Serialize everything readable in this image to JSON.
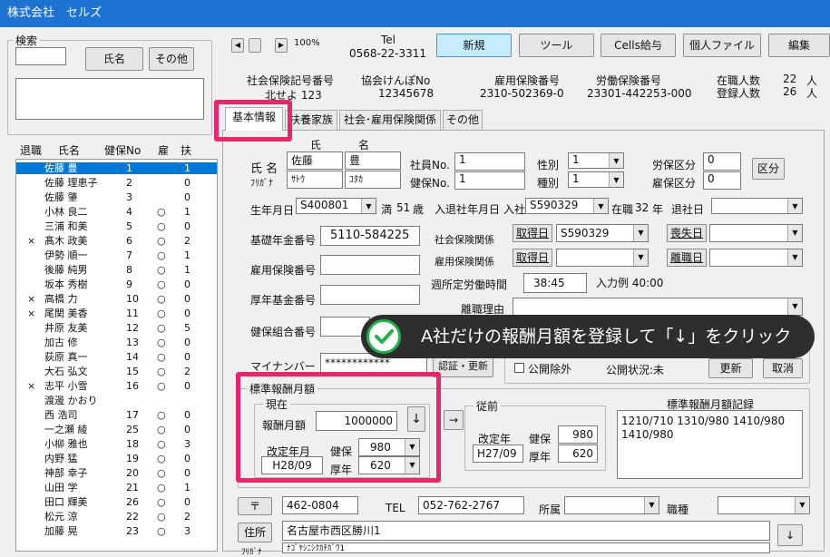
{
  "title": "株式会社　セルズ",
  "search": {
    "label": "検索",
    "name_btn": "氏名",
    "other_btn": "その他"
  },
  "list_headers": {
    "ret": "退職",
    "name": "氏名",
    "kenpo": "健保No",
    "emp": "雇",
    "dep": "扶"
  },
  "employees": [
    {
      "r": "",
      "n": "佐藤 豊",
      "k": "1",
      "e": "",
      "d": "1"
    },
    {
      "r": "",
      "n": "佐藤 理恵子",
      "k": "2",
      "e": "",
      "d": "0"
    },
    {
      "r": "",
      "n": "佐藤 肇",
      "k": "3",
      "e": "",
      "d": "0"
    },
    {
      "r": "",
      "n": "小林 良二",
      "k": "4",
      "e": "○",
      "d": "1"
    },
    {
      "r": "",
      "n": "三浦 和美",
      "k": "5",
      "e": "○",
      "d": "0"
    },
    {
      "r": "×",
      "n": "髙木 政美",
      "k": "6",
      "e": "○",
      "d": "2"
    },
    {
      "r": "",
      "n": "伊勢 順一",
      "k": "7",
      "e": "○",
      "d": "1"
    },
    {
      "r": "",
      "n": "後藤 純男",
      "k": "8",
      "e": "○",
      "d": "1"
    },
    {
      "r": "",
      "n": "坂本 秀樹",
      "k": "9",
      "e": "○",
      "d": "0"
    },
    {
      "r": "×",
      "n": "高橋 力",
      "k": "10",
      "e": "○",
      "d": "0"
    },
    {
      "r": "×",
      "n": "尾関 美香",
      "k": "11",
      "e": "○",
      "d": "0"
    },
    {
      "r": "",
      "n": "井原 友美",
      "k": "12",
      "e": "○",
      "d": "5"
    },
    {
      "r": "",
      "n": "加古 修",
      "k": "13",
      "e": "○",
      "d": "0"
    },
    {
      "r": "",
      "n": "荻原 真一",
      "k": "14",
      "e": "○",
      "d": "0"
    },
    {
      "r": "",
      "n": "大石 弘文",
      "k": "15",
      "e": "○",
      "d": "2"
    },
    {
      "r": "×",
      "n": "志平 小雪",
      "k": "16",
      "e": "○",
      "d": "0"
    },
    {
      "r": "",
      "n": "渡邊 かおり",
      "k": "",
      "e": "",
      "d": ""
    },
    {
      "r": "",
      "n": "西 浩司",
      "k": "17",
      "e": "○",
      "d": "0"
    },
    {
      "r": "",
      "n": "一之瀬 綾",
      "k": "25",
      "e": "○",
      "d": "0"
    },
    {
      "r": "",
      "n": "小柳 雅也",
      "k": "18",
      "e": "○",
      "d": "3"
    },
    {
      "r": "",
      "n": "内野 猛",
      "k": "19",
      "e": "○",
      "d": "0"
    },
    {
      "r": "",
      "n": "神部 幸子",
      "k": "20",
      "e": "○",
      "d": "0"
    },
    {
      "r": "",
      "n": "山田 学",
      "k": "21",
      "e": "○",
      "d": "1"
    },
    {
      "r": "",
      "n": "田口 輝美",
      "k": "26",
      "e": "○",
      "d": "0"
    },
    {
      "r": "",
      "n": "松元 涼",
      "k": "22",
      "e": "○",
      "d": "2"
    },
    {
      "r": "",
      "n": "加藤 晃",
      "k": "23",
      "e": "○",
      "d": "3"
    }
  ],
  "nav": {
    "zoom": "100%"
  },
  "header": {
    "tel_label": "Tel",
    "tel": "0568-22-3311",
    "btn_new": "新規",
    "btn_tool": "ツール",
    "btn_cells": "Cells給与",
    "btn_personal": "個人ファイル",
    "btn_edit": "編集"
  },
  "company": {
    "shaho_label": "社会保険記号番号",
    "shaho": "北せよ 123",
    "kyokai_label": "協会けんぽNo",
    "kyokai": "12345678",
    "koyo_label": "雇用保険番号",
    "koyo": "2310-502369-0",
    "rouho_label": "労働保険番号",
    "rouho": "23301-442253-000",
    "zaishoku_label": "在職人数",
    "zaishoku": "22",
    "toroku_label": "登録人数",
    "toroku": "26",
    "unit": "人"
  },
  "tabs": [
    "基本情報",
    "扶養家族",
    "社会･雇用保険関係",
    "その他"
  ],
  "form": {
    "sei_label": "氏",
    "mei_label": "名",
    "name_label": "氏 名",
    "kana_label": "ﾌﾘｶﾞﾅ",
    "sei": "佐藤",
    "mei": "豊",
    "sei_kana": "ｻﾄｳ",
    "mei_kana": "ﾕﾀｶ",
    "shain_label": "社員No.",
    "shain": "1",
    "kenpo_label": "健保No.",
    "kenpo": "1",
    "seibetsu_label": "性別",
    "seibetsu": "1",
    "shubetsu_label": "種別",
    "shubetsu": "1",
    "rouho_kubun_label": "労保区分",
    "rouho_kubun": "0",
    "koyo_kubun_label": "雇保区分",
    "koyo_kubun": "0",
    "kubun_btn": "区分",
    "birth_label": "生年月日",
    "birth": "S400801",
    "age_prefix": "満",
    "age": "51",
    "age_unit": "歳",
    "nyusha_label": "入退社年月日",
    "nyusha_prefix": "入社",
    "nyusha": "S590329",
    "zaishoku_prefix": "在職",
    "zaishoku_years": "32",
    "year_unit": "年",
    "taisha_label": "退社日",
    "kiso_label": "基礎年金番号",
    "kiso": "5110-584225",
    "shakai_label": "社会保険関係",
    "shutoku_btn": "取得日",
    "shakai_shutoku": "S590329",
    "soshitsu_btn": "喪失日",
    "koyo_label": "雇用保険番号",
    "koyo_kankei_label": "雇用保険関係",
    "koyo_shutoku_btn": "取得日",
    "rishoku_btn": "離職日",
    "kosei_label": "厚年基金番号",
    "shotei_label": "週所定労働時間",
    "shotei": "38:45",
    "nyuryoku_rei": "入力例 40:00",
    "rishoku_riyu_label": "離職理由",
    "kenko_label": "健保組合番号",
    "mynumber_label": "マイナンバー",
    "mynumber": "************",
    "ninsho_btn": "認証・更新",
    "koukai_label": "公開除外",
    "koukai_status": "公開状況:未",
    "koushin_btn": "更新",
    "torikeshi_btn": "取消"
  },
  "hyojun": {
    "group_label": "標準報酬月額",
    "current_label": "現在",
    "hoshu_label": "報酬月額",
    "hoshu": "1000000",
    "down_btn": "↓",
    "kaitei_label": "改定年月",
    "kaitei": "H28/09",
    "kenpo_label": "健保",
    "kenpo": "980",
    "kosei_label": "厚年",
    "kosei": "620",
    "arrow_btn": "→",
    "prev_label": "従前",
    "prev_kaitei_label": "改定年",
    "prev_kaitei": "H27/09",
    "prev_kenpo": "980",
    "prev_kosei": "620",
    "record_label": "標準報酬月額記録",
    "record": "1210/710  1310/980 1410/980 1410/980"
  },
  "address": {
    "zip_btn": "〒",
    "zip": "462-0804",
    "tel_label": "TEL",
    "tel": "052-762-2767",
    "shozoku_label": "所属",
    "shokushu_label": "職種",
    "jusho_btn": "住所",
    "jusho": "名古屋市西区勝川1",
    "kana_label": "ﾌﾘｶﾞﾅ",
    "kana": "ﾅｺﾞﾔｼﾆｼｸｶﾁｶﾞﾜ1",
    "down_btn": "↓"
  },
  "tooltip": "A社だけの報酬月額を登録して「↓」をクリック",
  "colors": {
    "titlebar": "#1e73d2",
    "highlight": "#e8266b",
    "selected": "#0078d7",
    "tooltip_bg": "#2e2e2e",
    "check": "#22b14c"
  }
}
